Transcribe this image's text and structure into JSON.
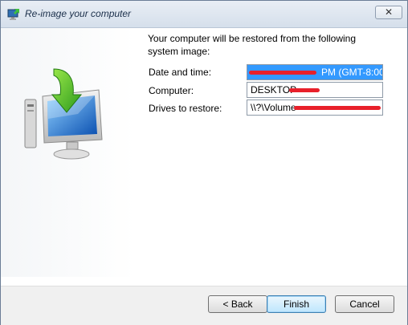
{
  "window": {
    "title": "Re-image your computer"
  },
  "icons": {
    "title_icon": "reimage-icon",
    "illustration": "monitor-restore-icon",
    "close": "close-icon"
  },
  "content": {
    "description": "Your computer will be restored from the following system image:",
    "fields": [
      {
        "label": "Date and time:",
        "value": "PM (GMT-8:00)",
        "selected": true
      },
      {
        "label": "Computer:",
        "value": "DESKTOP",
        "selected": false
      },
      {
        "label": "Drives to restore:",
        "value": "\\\\?\\Volume",
        "selected": false
      }
    ]
  },
  "footer": {
    "back_label": "< Back",
    "finish_label": "Finish",
    "cancel_label": "Cancel"
  },
  "colors": {
    "selection": "#3399ff",
    "redaction": "#e8202a",
    "default_button_border": "#3c7fb1"
  }
}
